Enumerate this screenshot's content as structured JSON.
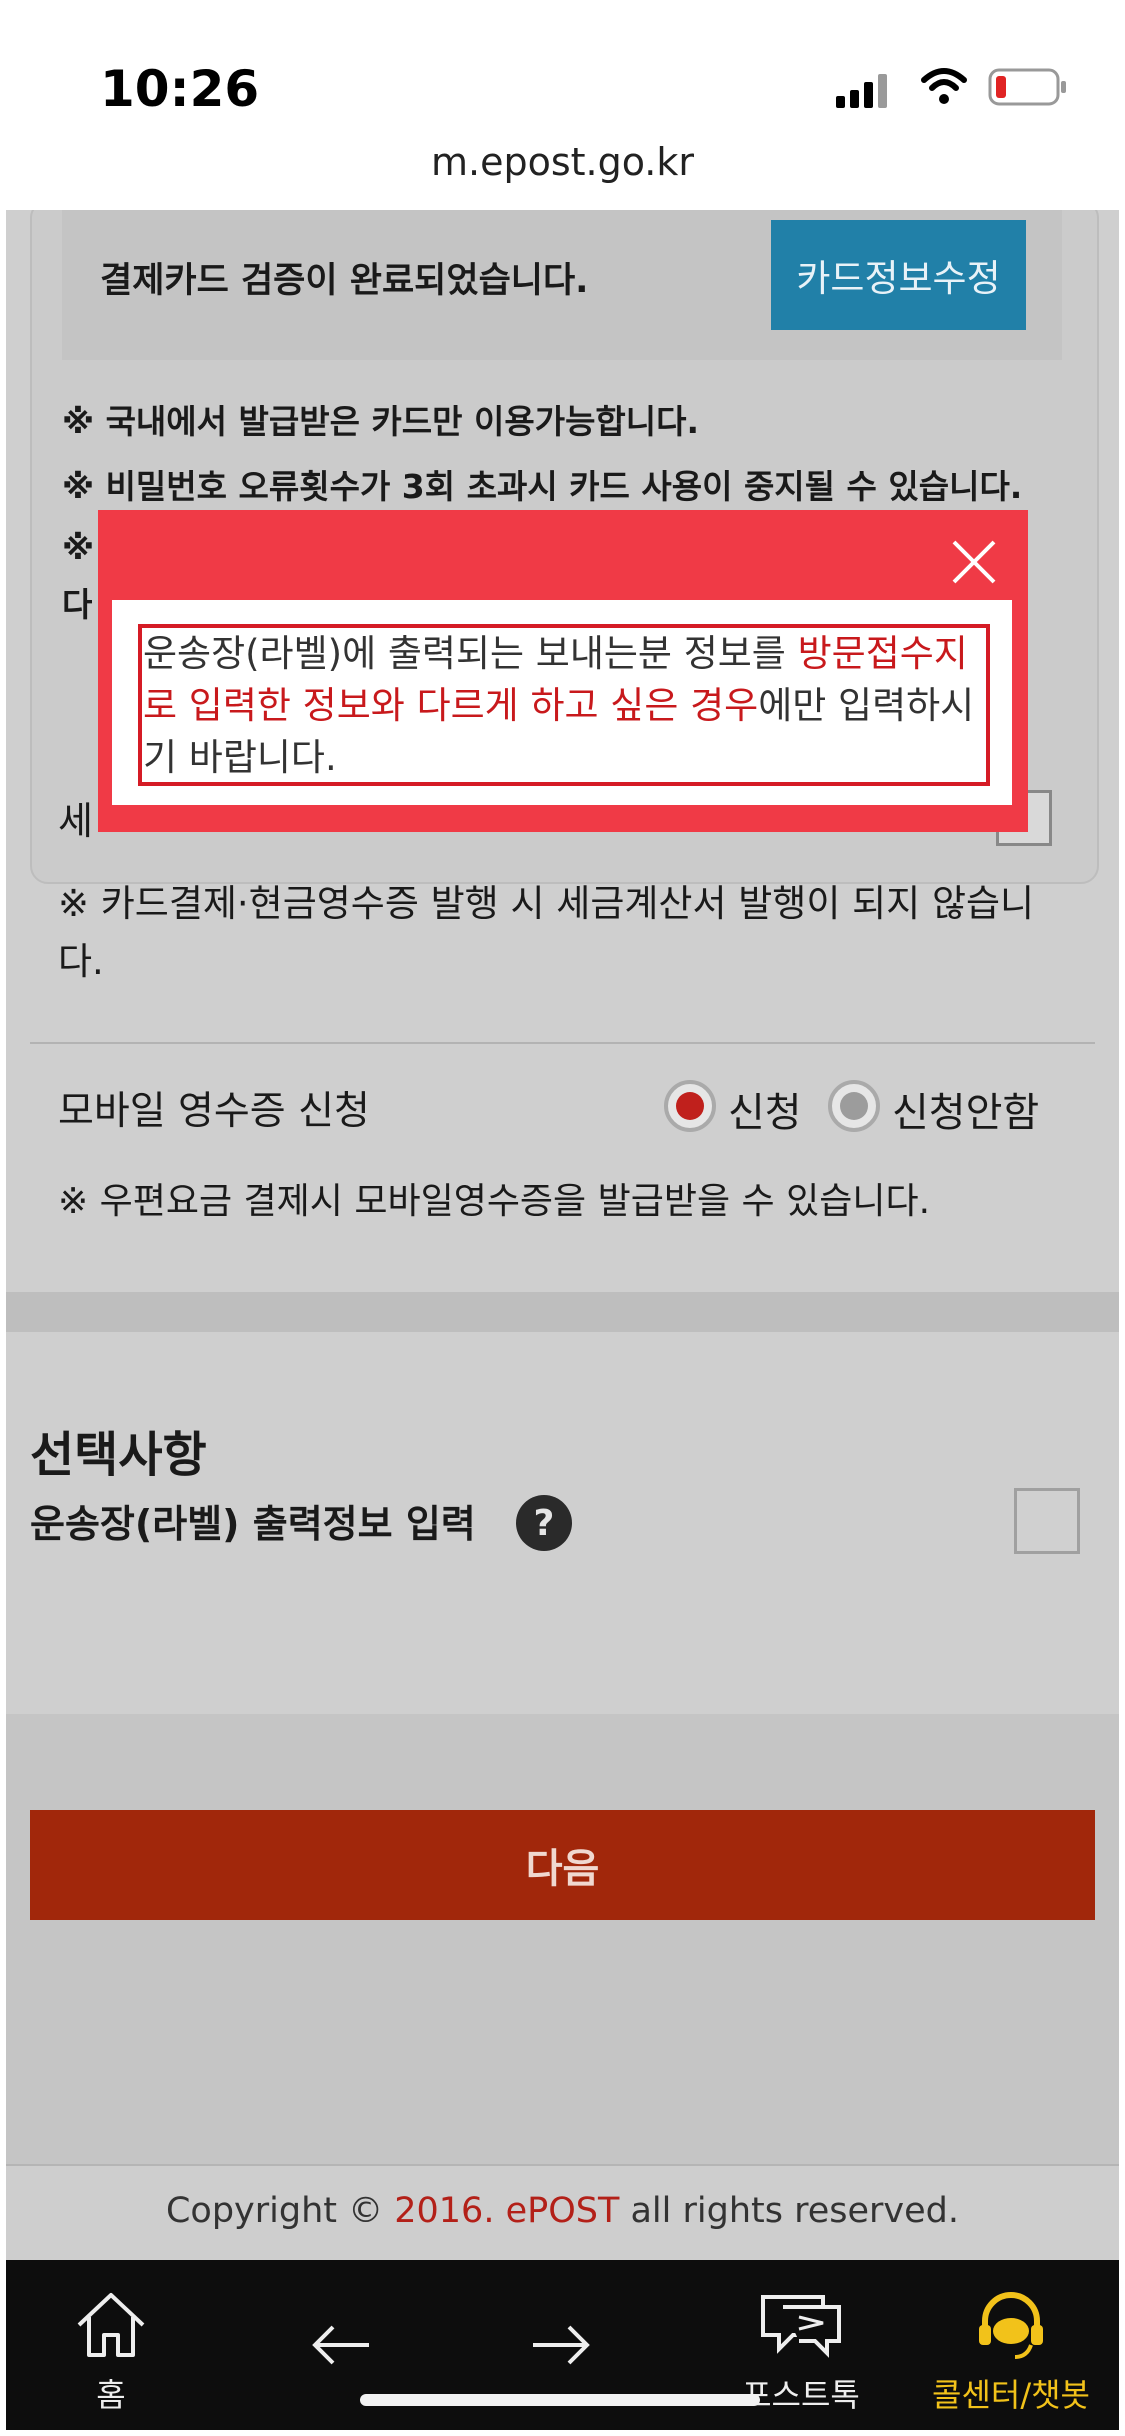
{
  "status_bar": {
    "time": "10:26",
    "url": "m.epost.go.kr"
  },
  "card": {
    "verify_text": "결제카드 검증이 완료되었습니다.",
    "edit_button": "카드정보수정",
    "notices": [
      "※ 국내에서 발급받은 카드만 이용가능합니다.",
      "※ 비밀번호 오류횟수가 3회 초과시 카드 사용이 중지될 수 있습니다.",
      "※",
      "다"
    ]
  },
  "tax": {
    "row_label": "세",
    "note": "※ 카드결제·현금영수증 발행 시 세금계산서 발행이 되지 않습니다."
  },
  "mobile_receipt": {
    "label": "모바일 영수증 신청",
    "options": [
      "신청",
      "신청안함"
    ],
    "selected": "신청",
    "note": "※ 우편요금 결제시 모바일영수증을 발급받을 수 있습니다."
  },
  "options": {
    "title": "선택사항",
    "label_info": "운송장(라벨) 출력정보 입력",
    "help_icon": "?"
  },
  "next_button": "다음",
  "footer": {
    "prefix": "Copyright © ",
    "year": "2016. ePOST",
    "suffix": " all rights reserved."
  },
  "modal": {
    "text_normal_1": "운송장(라벨)에 출력되는 보내는분 정보를 ",
    "text_highlight": "방문접수지로 입력한 정보와 다르게 하고 싶은 경우",
    "text_normal_2": "에만 입력하시기 바랍니다."
  },
  "bottom_nav": {
    "items": [
      {
        "label": "홈",
        "icon": "home-icon"
      },
      {
        "label": "",
        "icon": "back-arrow-icon"
      },
      {
        "label": "",
        "icon": "forward-arrow-icon"
      },
      {
        "label": "포스트톡",
        "icon": "post-talk-icon"
      },
      {
        "label": "콜센터/챗봇",
        "icon": "call-center-icon"
      }
    ]
  },
  "colors": {
    "accent_red": "#a1270b",
    "modal_red": "#f03a46",
    "edit_blue": "#2180a8",
    "call_yellow": "#f2c21a"
  }
}
